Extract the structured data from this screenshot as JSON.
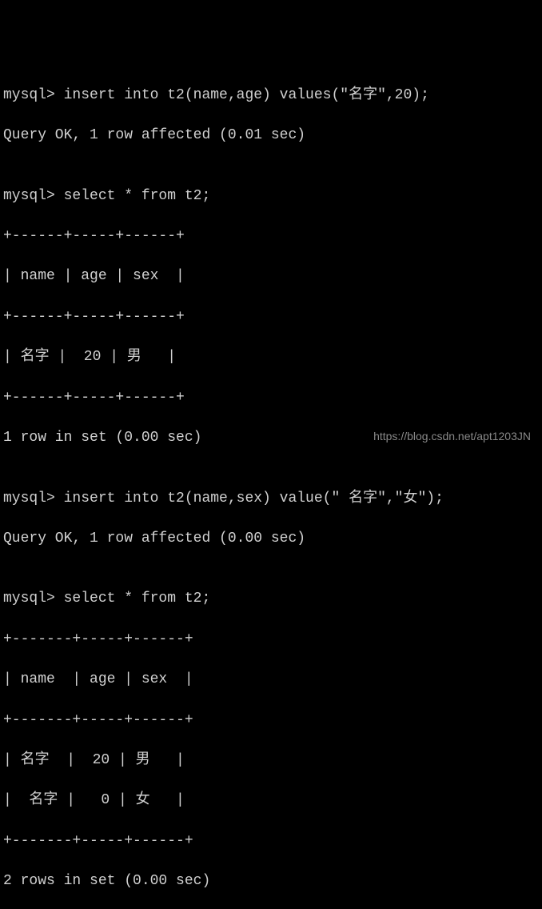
{
  "lines": {
    "l01": "mysql> insert into t2(name,age) values(\"名字\",20);",
    "l02": "Query OK, 1 row affected (0.01 sec)",
    "l03": "",
    "l04": "mysql> select * from t2;",
    "l05": "+------+-----+------+",
    "l06": "| name | age | sex  |",
    "l07": "+------+-----+------+",
    "l08": "| 名字 |  20 | 男   |",
    "l09": "+------+-----+------+",
    "l10": "1 row in set (0.00 sec)",
    "l11": "",
    "l12": "mysql> insert into t2(name,sex) value(\" 名字\",\"女\");",
    "l13": "Query OK, 1 row affected (0.00 sec)",
    "l14": "",
    "l15": "mysql> select * from t2;",
    "l16": "+-------+-----+------+",
    "l17": "| name  | age | sex  |",
    "l18": "+-------+-----+------+",
    "l19": "| 名字  |  20 | 男   |",
    "l20": "|  名字 |   0 | 女   |",
    "l21": "+-------+-----+------+",
    "l22": "2 rows in set (0.00 sec)"
  },
  "watermark": "https://blog.csdn.net/apt1203JN"
}
